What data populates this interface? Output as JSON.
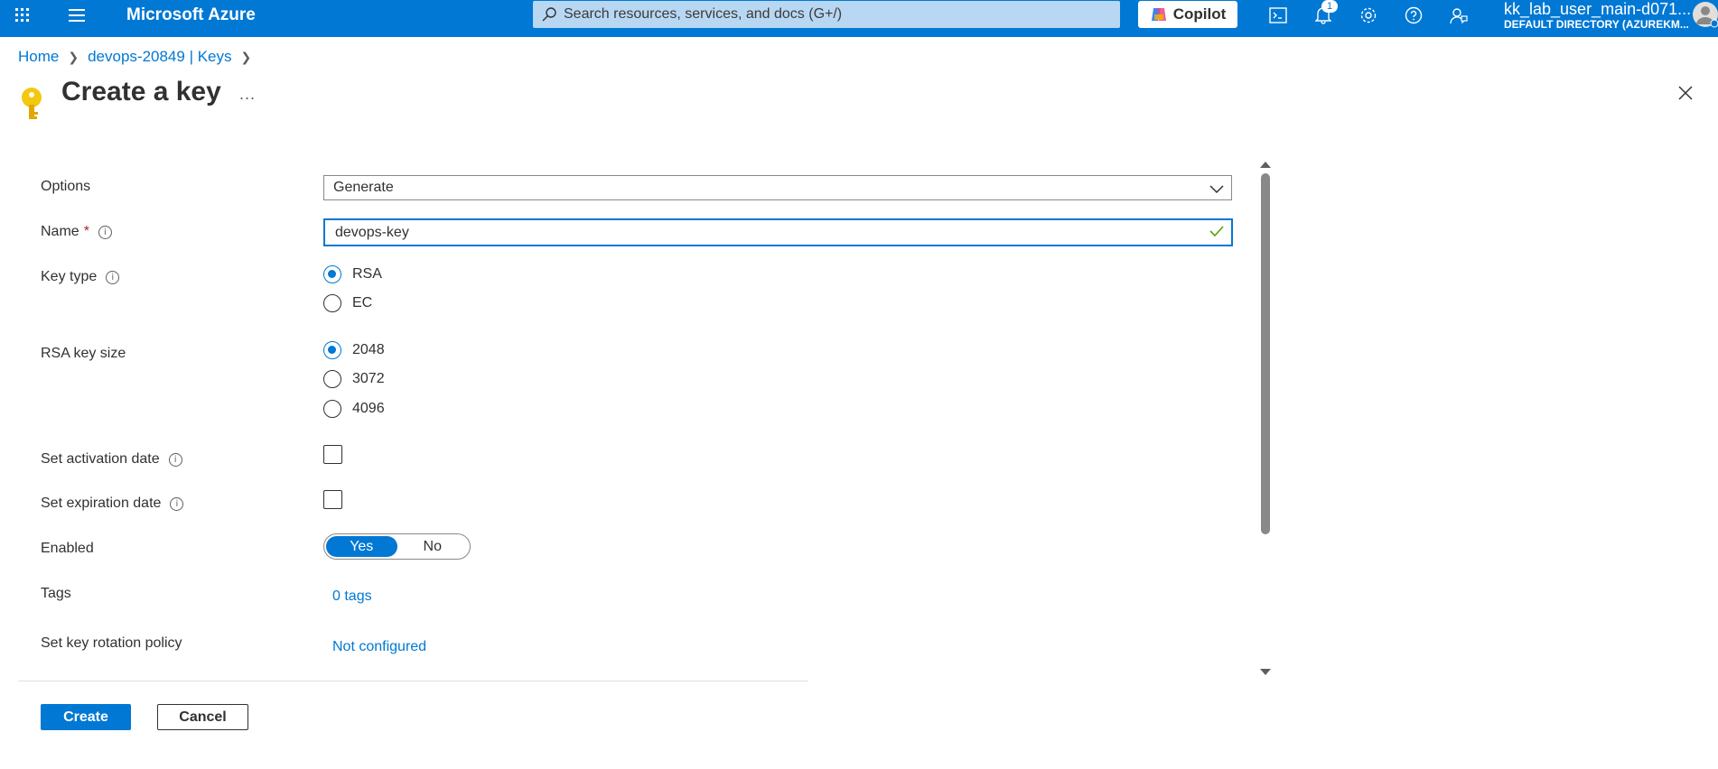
{
  "topbar": {
    "brand": "Microsoft Azure",
    "search_placeholder": "Search resources, services, and docs (G+/)",
    "copilot_label": "Copilot",
    "notification_count": "1",
    "user_name": "kk_lab_user_main-d071...",
    "user_directory": "DEFAULT DIRECTORY (AZUREKM..."
  },
  "breadcrumb": {
    "home": "Home",
    "vault": "devops-20849 | Keys"
  },
  "page": {
    "title": "Create a key",
    "more": "..."
  },
  "form": {
    "options_label": "Options",
    "options_value": "Generate",
    "name_label": "Name",
    "name_required": "*",
    "name_value": "devops-key",
    "key_type_label": "Key type",
    "key_type_options": [
      "RSA",
      "EC"
    ],
    "key_type_selected": "RSA",
    "rsa_size_label": "RSA key size",
    "rsa_size_options": [
      "2048",
      "3072",
      "4096"
    ],
    "rsa_size_selected": "2048",
    "activation_label": "Set activation date",
    "expiration_label": "Set expiration date",
    "enabled_label": "Enabled",
    "enabled_yes": "Yes",
    "enabled_no": "No",
    "enabled_selected": "Yes",
    "tags_label": "Tags",
    "tags_value": "0 tags",
    "rotation_label": "Set key rotation policy",
    "rotation_value": "Not configured"
  },
  "actions": {
    "create": "Create",
    "cancel": "Cancel"
  },
  "colors": {
    "accent": "#0078d4",
    "required": "#a4262c",
    "key_icon": "#f2c811"
  }
}
